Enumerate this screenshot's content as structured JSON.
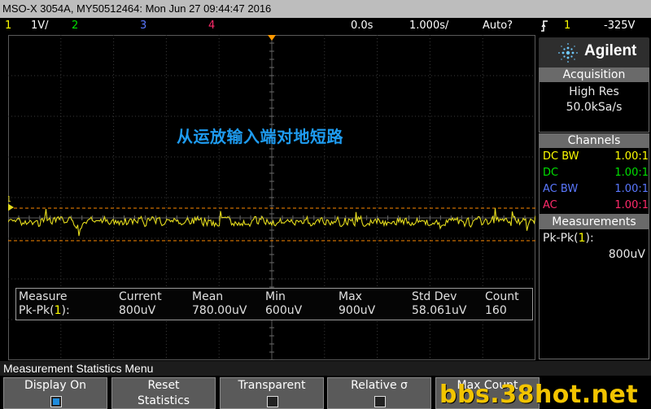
{
  "title": "MSO-X 3054A, MY50512464: Mon Jun 27 09:44:47 2016",
  "status_bar": {
    "ch1_num": "1",
    "ch1_scale": "1Ⅴ/",
    "ch2_num": "2",
    "ch3_num": "3",
    "ch4_num": "4",
    "delay": "0.0s",
    "timebase": "1.000s/",
    "trigger_mode": "Auto?",
    "trigger_icon": "trigger-rising-edge-icon",
    "trigger_src": "1",
    "trigger_level": "-325Ⅴ"
  },
  "annotation": "从运放输入端对地短路",
  "waveform": {
    "channel_marker": "1",
    "color": "#e5dc1c",
    "cursor_color": "#ff8a00",
    "trigger_marker_color": "#ff9900"
  },
  "measurement_table": {
    "headers": [
      "Measure",
      "Current",
      "Mean",
      "Min",
      "Max",
      "Std Dev",
      "Count"
    ],
    "row_prefix": "Pk-Pk(",
    "row_channel": "1",
    "row_suffix": "):",
    "values": [
      "800uV",
      "780.00uV",
      "600uV",
      "900uV",
      "58.061uV",
      "160"
    ]
  },
  "panel": {
    "logo_text": "Agilent",
    "acquisition": {
      "header": "Acquisition",
      "mode": "High Res",
      "rate": "50.0kSa/s"
    },
    "channels": {
      "header": "Channels",
      "rows": [
        {
          "coupling": "DC BW",
          "value": "1.00:1",
          "color": "#ffff00"
        },
        {
          "coupling": "DC",
          "value": "1.00:1",
          "color": "#00e000"
        },
        {
          "coupling": "AC BW",
          "value": "1.00:1",
          "color": "#5a78ff"
        },
        {
          "coupling": "AC",
          "value": "1.00:1",
          "color": "#ff2a6a"
        }
      ]
    },
    "measurements": {
      "header": "Measurements",
      "label_prefix": "Pk-Pk(",
      "label_channel": "1",
      "label_suffix": "):",
      "value": "800uV"
    }
  },
  "menu": {
    "label": "Measurement Statistics Menu",
    "softkeys": [
      {
        "line1": "Display On",
        "checked": true
      },
      {
        "line1": "Reset",
        "line2": "Statistics"
      },
      {
        "line1": "Transparent",
        "checked": false
      },
      {
        "line1": "Relative σ",
        "checked": false
      },
      {
        "line1": "Max Count"
      }
    ]
  },
  "watermark": "bbs.38hot.net"
}
